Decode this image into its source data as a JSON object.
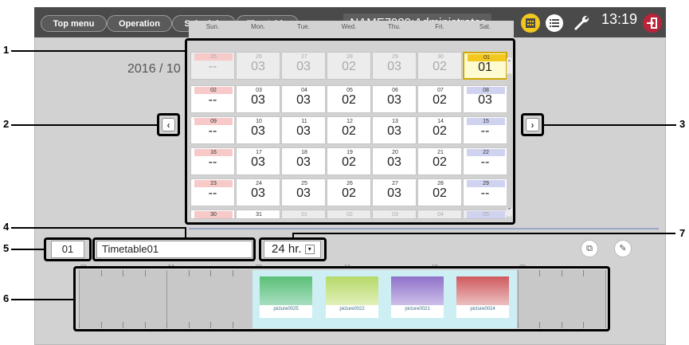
{
  "nav": {
    "top_menu": "Top menu",
    "operation": "Operation",
    "schedule": "Schedule",
    "timetable": "Timetable"
  },
  "user": "NAME7989:Administrator",
  "clock": "13:19",
  "icons": {
    "calendar": "calendar-icon",
    "list": "list-icon",
    "tool": "wrench-icon",
    "logout": "logout-icon",
    "prev": "chevron-left-icon",
    "next": "chevron-right-icon",
    "copy": "copy-icon",
    "edit": "pencil-icon"
  },
  "current_date": "2016 / 10",
  "callouts": [
    "1",
    "2",
    "3",
    "4",
    "5",
    "6",
    "7"
  ],
  "calendar": {
    "weekdays": [
      "Sun.",
      "Mon.",
      "Tue.",
      "Wed.",
      "Thu.",
      "Fri.",
      "Sat."
    ],
    "rows": [
      [
        {
          "d": "25",
          "v": "--",
          "dim": true
        },
        {
          "d": "26",
          "v": "03",
          "dim": true
        },
        {
          "d": "27",
          "v": "03",
          "dim": true
        },
        {
          "d": "28",
          "v": "02",
          "dim": true
        },
        {
          "d": "29",
          "v": "03",
          "dim": true
        },
        {
          "d": "30",
          "v": "02",
          "dim": true
        },
        {
          "d": "01",
          "v": "01",
          "today": true
        }
      ],
      [
        {
          "d": "02",
          "v": "--"
        },
        {
          "d": "03",
          "v": "03"
        },
        {
          "d": "04",
          "v": "03"
        },
        {
          "d": "05",
          "v": "02"
        },
        {
          "d": "06",
          "v": "03"
        },
        {
          "d": "07",
          "v": "02"
        },
        {
          "d": "08",
          "v": "03"
        }
      ],
      [
        {
          "d": "09",
          "v": "--"
        },
        {
          "d": "10",
          "v": "03"
        },
        {
          "d": "11",
          "v": "03"
        },
        {
          "d": "12",
          "v": "02"
        },
        {
          "d": "13",
          "v": "03"
        },
        {
          "d": "14",
          "v": "02"
        },
        {
          "d": "15",
          "v": "--"
        }
      ],
      [
        {
          "d": "16",
          "v": "--"
        },
        {
          "d": "17",
          "v": "03"
        },
        {
          "d": "18",
          "v": "03"
        },
        {
          "d": "19",
          "v": "02"
        },
        {
          "d": "20",
          "v": "03"
        },
        {
          "d": "21",
          "v": "02"
        },
        {
          "d": "22",
          "v": "--"
        }
      ],
      [
        {
          "d": "23",
          "v": "--"
        },
        {
          "d": "24",
          "v": "03"
        },
        {
          "d": "25",
          "v": "03"
        },
        {
          "d": "26",
          "v": "02"
        },
        {
          "d": "27",
          "v": "03"
        },
        {
          "d": "28",
          "v": "02"
        },
        {
          "d": "29",
          "v": "--"
        }
      ],
      [
        {
          "d": "30",
          "v": ""
        },
        {
          "d": "31",
          "v": ""
        },
        {
          "d": "01",
          "v": "",
          "dim": true
        },
        {
          "d": "02",
          "v": "",
          "dim": true
        },
        {
          "d": "03",
          "v": "",
          "dim": true
        },
        {
          "d": "04",
          "v": "",
          "dim": true
        },
        {
          "d": "05",
          "v": "",
          "dim": true
        }
      ]
    ]
  },
  "timetable": {
    "number": "01",
    "name": "Timetable01",
    "range_options": [
      "24 hr."
    ],
    "range_selected": "24 hr.",
    "axis_labels": [
      "00",
      "04",
      "08",
      "12",
      "16",
      "20"
    ],
    "pictures": [
      {
        "name": "picture0025",
        "color_top": "#5bbf77",
        "color_bottom": "#a8dfc1"
      },
      {
        "name": "picture0022",
        "color_top": "#b6d96a",
        "color_bottom": "#e1f0b9"
      },
      {
        "name": "picture0021",
        "color_top": "#8f72c9",
        "color_bottom": "#cdbfe9"
      },
      {
        "name": "picture0024",
        "color_top": "#cf5a5e",
        "color_bottom": "#ecc0c1"
      }
    ]
  },
  "colors": {
    "accent": "#f2c71e",
    "logout": "#b8243a",
    "topbar": "#4a4a4a"
  }
}
